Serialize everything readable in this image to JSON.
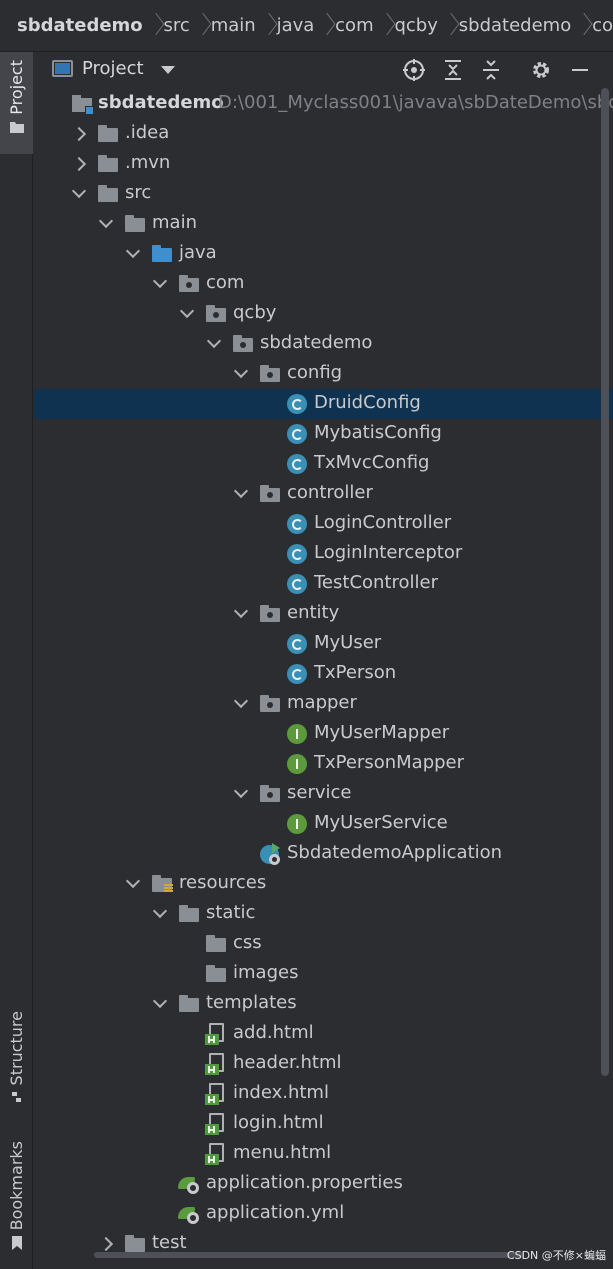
{
  "breadcrumb": [
    "sbdatedemo",
    "src",
    "main",
    "java",
    "com",
    "qcby",
    "sbdatedemo",
    "co"
  ],
  "left_stripe": {
    "project_label": "Project",
    "structure_label": "Structure",
    "bookmarks_label": "Bookmarks"
  },
  "toolbar": {
    "title": "Project"
  },
  "tree": {
    "root": {
      "label": "sbdatedemo",
      "path": "D:\\001_Myclass001\\javava\\sbDateDemo\\sbd"
    },
    "idea": ".idea",
    "mvn": ".mvn",
    "src": "src",
    "main": "main",
    "java": "java",
    "com": "com",
    "qcby": "qcby",
    "sbdatedemo": "sbdatedemo",
    "config": "config",
    "druid_config": "DruidConfig",
    "mybatis_config": "MybatisConfig",
    "txmvc_config": "TxMvcConfig",
    "controller": "controller",
    "login_controller": "LoginController",
    "login_interceptor": "LoginInterceptor",
    "test_controller": "TestController",
    "entity": "entity",
    "my_user": "MyUser",
    "tx_person": "TxPerson",
    "mapper": "mapper",
    "my_user_mapper": "MyUserMapper",
    "tx_person_mapper": "TxPersonMapper",
    "service": "service",
    "my_user_service": "MyUserService",
    "application_class": "SbdatedemoApplication",
    "resources": "resources",
    "static": "static",
    "css": "css",
    "images": "images",
    "templates": "templates",
    "add_html": "add.html",
    "header_html": "header.html",
    "index_html": "index.html",
    "login_html": "login.html",
    "menu_html": "menu.html",
    "app_properties": "application.properties",
    "app_yml": "application.yml",
    "test": "test"
  },
  "watermark": "CSDN @不修×蝙蝠",
  "colors": {
    "background": "#2b2d30",
    "selection": "#0e3250",
    "class_icon": "#3a8fb5",
    "interface_icon": "#5c9a3c",
    "source_folder": "#3f8fce"
  }
}
